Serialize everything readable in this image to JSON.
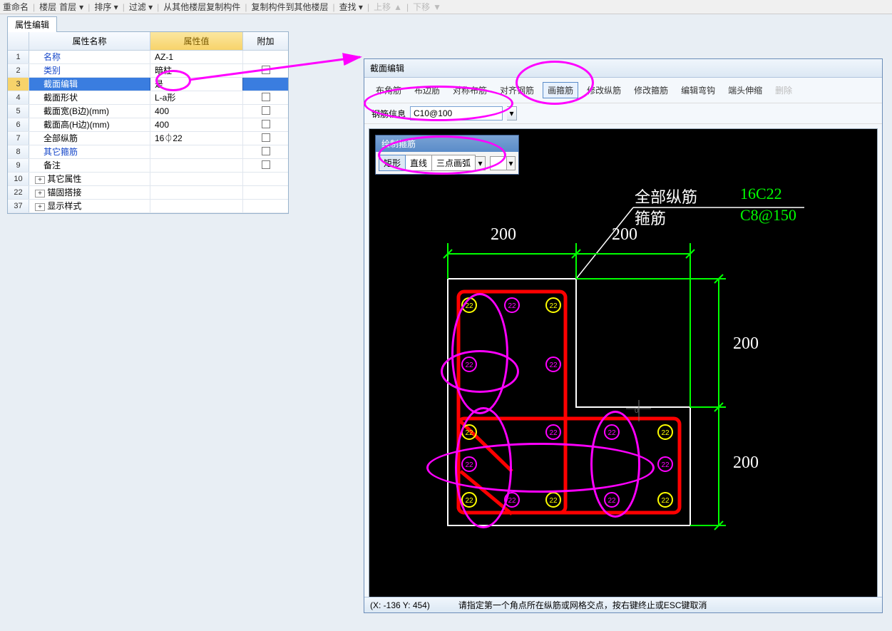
{
  "toolbar": {
    "t1": "重命名",
    "t2": "楼层",
    "t3": "首层",
    "sort": "排序 ▾",
    "filter": "过滤 ▾",
    "copyFrom": "从其他楼层复制构件",
    "copyTo": "复制构件到其他楼层",
    "find": "查找 ▾",
    "moveUp": "上移",
    "moveDown": "下移"
  },
  "leftTab": "属性编辑",
  "gridHeader": {
    "name": "属性名称",
    "value": "属性值",
    "extra": "附加"
  },
  "rows": [
    {
      "num": "1",
      "name": "名称",
      "val": "AZ-1",
      "link": true,
      "chk": false
    },
    {
      "num": "2",
      "name": "类别",
      "val": "暗柱",
      "link": true,
      "chk": true
    },
    {
      "num": "3",
      "name": "截面编辑",
      "val": "是",
      "link": false,
      "chk": false,
      "selected": true
    },
    {
      "num": "4",
      "name": "截面形状",
      "val": "L-a形",
      "link": false,
      "chk": true
    },
    {
      "num": "5",
      "name": "截面宽(B边)(mm)",
      "val": "400",
      "link": false,
      "chk": true
    },
    {
      "num": "6",
      "name": "截面高(H边)(mm)",
      "val": "400",
      "link": false,
      "chk": true
    },
    {
      "num": "7",
      "name": "全部纵筋",
      "val": "16⏀22",
      "link": false,
      "chk": true
    },
    {
      "num": "8",
      "name": "其它箍筋",
      "val": "",
      "link": true,
      "chk": true
    },
    {
      "num": "9",
      "name": "备注",
      "val": "",
      "link": false,
      "chk": true
    },
    {
      "num": "10",
      "name": "其它属性",
      "val": "",
      "link": false,
      "chk": false,
      "expand": true
    },
    {
      "num": "22",
      "name": "锚固搭接",
      "val": "",
      "link": false,
      "chk": false,
      "expand": true
    },
    {
      "num": "37",
      "name": "显示样式",
      "val": "",
      "link": false,
      "chk": false,
      "expand": true
    }
  ],
  "rightPanel": {
    "title": "截面编辑",
    "tools": {
      "t1": "布角筋",
      "t2": "布边筋",
      "t3": "对称布筋",
      "t4": "对齐钢筋",
      "t5": "画箍筋",
      "t6": "修改纵筋",
      "t7": "修改箍筋",
      "t8": "编辑弯钩",
      "t9": "端头伸缩",
      "t10": "删除"
    },
    "rebarInfoLabel": "钢筋信息",
    "rebarInfo": "C10@100",
    "floatTitle": "绘制箍筋",
    "floatOpts": {
      "o1": "矩形",
      "o2": "直线",
      "o3": "三点画弧"
    }
  },
  "canvasText": {
    "label1": "全部纵筋",
    "val1": "16C22",
    "label2": "箍筋",
    "val2": "C8@150",
    "dim200a": "200",
    "dim200b": "200",
    "dim200c": "200",
    "dim200d": "200"
  },
  "status": {
    "coords": "(X: -136 Y: 454)",
    "hint": "请指定第一个角点所在纵筋或网格交点，按右键终止或ESC键取消"
  }
}
